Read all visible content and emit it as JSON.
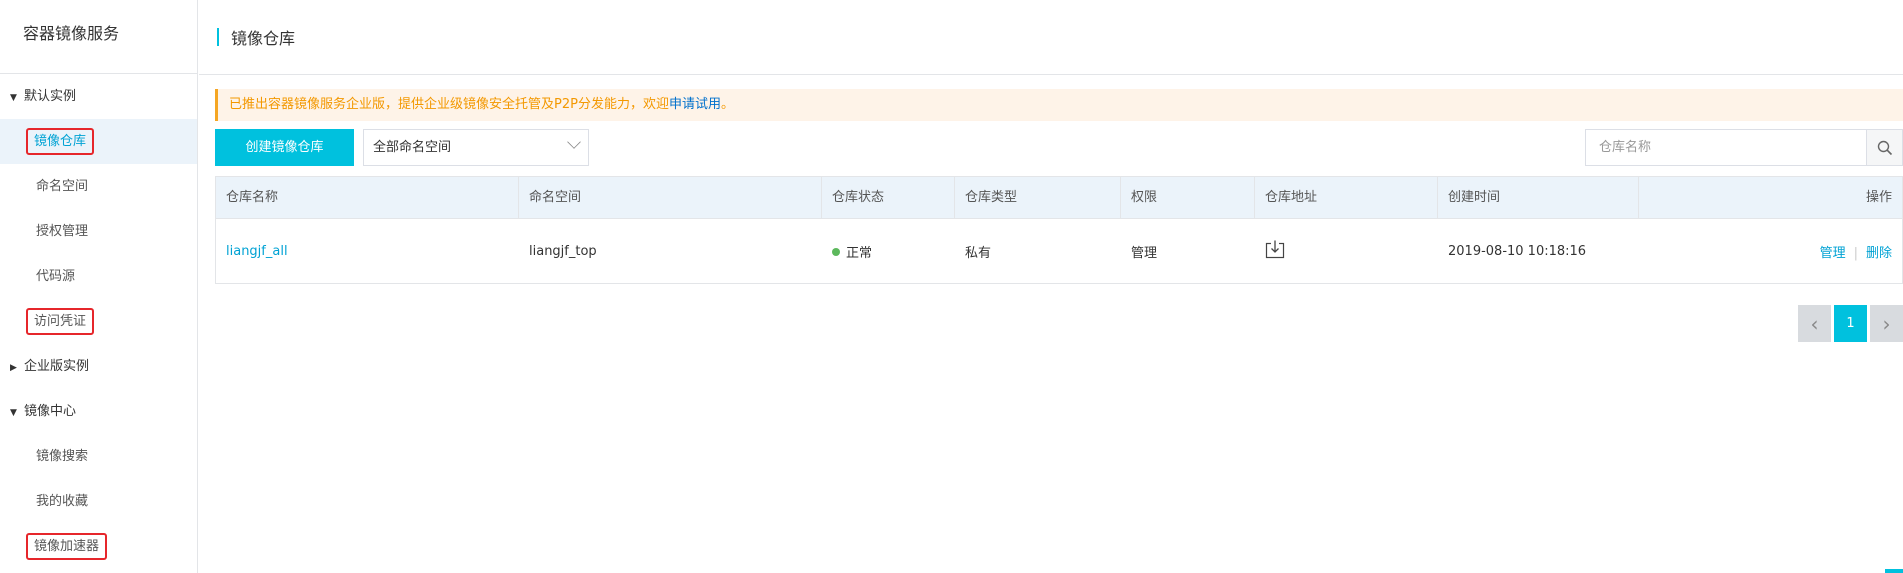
{
  "sidebar": {
    "brand": "容器镜像服务",
    "groups": [
      {
        "label": "默认实例",
        "caret": "▼"
      },
      {
        "label": "企业版实例",
        "caret": "▶"
      },
      {
        "label": "镜像中心",
        "caret": "▼"
      }
    ],
    "items_default": [
      "镜像仓库",
      "命名空间",
      "授权管理",
      "代码源",
      "访问凭证"
    ],
    "items_center": [
      "镜像搜索",
      "我的收藏",
      "镜像加速器"
    ]
  },
  "header": {
    "title": "镜像仓库"
  },
  "notice": {
    "text": "已推出容器镜像服务企业版，提供企业级镜像安全托管及P2P分发能力，欢迎",
    "link": "申请试用",
    "suffix": "。"
  },
  "toolbar": {
    "create_label": "创建镜像仓库",
    "namespace_select": "全部命名空间",
    "search_placeholder": "仓库名称"
  },
  "table": {
    "headers": [
      "仓库名称",
      "命名空间",
      "仓库状态",
      "仓库类型",
      "权限",
      "仓库地址",
      "创建时间",
      "操作"
    ],
    "rows": [
      {
        "name": "liangjf_all",
        "namespace": "liangjf_top",
        "status": "正常",
        "type": "私有",
        "permission": "管理",
        "created": "2019-08-10 10:18:16",
        "action_manage": "管理",
        "action_sep": "|",
        "action_delete": "删除"
      }
    ]
  },
  "pager": {
    "current": "1",
    "prev": "‹",
    "next": "›"
  },
  "colors": {
    "accent": "#00c1de",
    "link": "#00a2d4",
    "highlight": "#e6262b",
    "notice_text": "#f39800",
    "status_ok": "#5cb85c"
  }
}
